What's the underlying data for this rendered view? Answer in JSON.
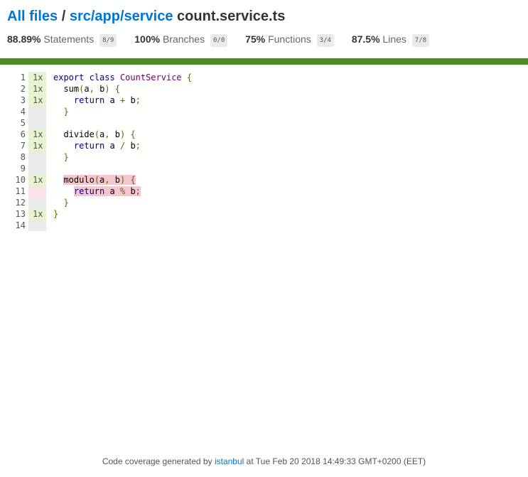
{
  "breadcrumb": {
    "all_files": "All files",
    "separator": "/",
    "folder": "src/app/service",
    "file": "count.service.ts"
  },
  "summary": [
    {
      "pct": "88.89%",
      "label": "Statements",
      "fraction": "8/9"
    },
    {
      "pct": "100%",
      "label": "Branches",
      "fraction": "0/0"
    },
    {
      "pct": "75%",
      "label": "Functions",
      "fraction": "3/4"
    },
    {
      "pct": "87.5%",
      "label": "Lines",
      "fraction": "7/8"
    }
  ],
  "status_color": "#4d8b29",
  "lines": [
    {
      "n": "1",
      "hits": "1x",
      "status": "yes",
      "code": "export class CountService {"
    },
    {
      "n": "2",
      "hits": "1x",
      "status": "yes",
      "code": "  sum(a, b) {"
    },
    {
      "n": "3",
      "hits": "1x",
      "status": "yes",
      "code": "    return a + b;"
    },
    {
      "n": "4",
      "hits": "",
      "status": "neutral",
      "code": "  }"
    },
    {
      "n": "5",
      "hits": "",
      "status": "neutral",
      "code": ""
    },
    {
      "n": "6",
      "hits": "1x",
      "status": "yes",
      "code": "  divide(a, b) {"
    },
    {
      "n": "7",
      "hits": "1x",
      "status": "yes",
      "code": "    return a / b;"
    },
    {
      "n": "8",
      "hits": "",
      "status": "neutral",
      "code": "  }"
    },
    {
      "n": "9",
      "hits": "",
      "status": "neutral",
      "code": ""
    },
    {
      "n": "10",
      "hits": "1x",
      "status": "yes",
      "code": "  modulo(a, b) {"
    },
    {
      "n": "11",
      "hits": "",
      "status": "no",
      "code": "    return a % b;"
    },
    {
      "n": "12",
      "hits": "",
      "status": "neutral",
      "code": "  }"
    },
    {
      "n": "13",
      "hits": "1x",
      "status": "yes",
      "code": "}"
    },
    {
      "n": "14",
      "hits": "",
      "status": "neutral",
      "code": ""
    }
  ],
  "footer": {
    "prefix": "Code coverage generated by",
    "link": "istanbul",
    "suffix": "at Tue Feb 20 2018 14:49:33 GMT+0200 (EET)"
  }
}
